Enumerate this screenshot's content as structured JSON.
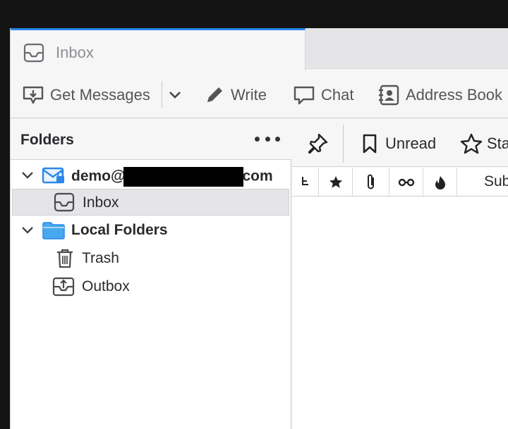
{
  "tab": {
    "label": "Inbox",
    "icon": "inbox-icon"
  },
  "toolbar": {
    "get_messages": "Get Messages",
    "write": "Write",
    "chat": "Chat",
    "address_book": "Address Book"
  },
  "folder_pane": {
    "title": "Folders",
    "account": {
      "name_prefix": "demo@",
      "name_suffix": "com",
      "icon": "mail-account-icon"
    },
    "local_folders": "Local Folders",
    "folders": [
      {
        "label": "Inbox",
        "icon": "inbox-icon",
        "selected": true
      },
      {
        "label": "Trash",
        "icon": "trash-icon"
      },
      {
        "label": "Outbox",
        "icon": "outbox-icon"
      }
    ]
  },
  "thread_pane": {
    "unread": "Unread",
    "starred": "Sta",
    "columns": {
      "subject": "Sub"
    }
  },
  "colors": {
    "accent": "#2b87e9",
    "folder_blue": "#47a8f0",
    "selected_row": "#e5e5e7"
  }
}
